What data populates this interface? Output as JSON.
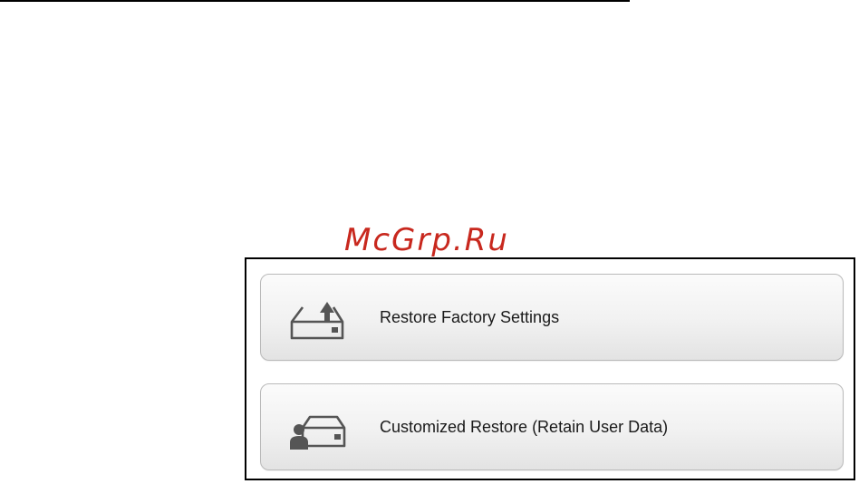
{
  "watermark": "McGrp.Ru",
  "options": [
    {
      "label": "Restore Factory Settings",
      "icon": "drive-upload-icon"
    },
    {
      "label": "Customized Restore (Retain User Data)",
      "icon": "drive-user-icon"
    }
  ],
  "colors": {
    "watermark": "#c8281e",
    "icon": "#555555",
    "button_border": "#b9b9b9"
  }
}
